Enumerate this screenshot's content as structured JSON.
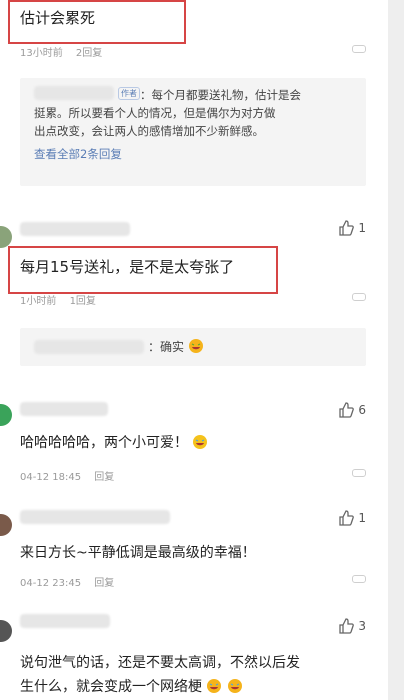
{
  "comments": [
    {
      "text": "估计会累死",
      "time": "13小时前",
      "replies": "2回复"
    },
    {
      "text": "每月15号送礼，是不是太夸张了",
      "time": "1小时前",
      "replies": "1回复",
      "likes": "1"
    },
    {
      "text": "哈哈哈哈哈，两个小可爱！",
      "time": "04-12 18:45",
      "reply_action": "回复",
      "likes": "6"
    },
    {
      "text": "来日方长~平静低调是最高级的幸福！",
      "time": "04-12 23:45",
      "reply_action": "回复",
      "likes": "1"
    },
    {
      "text_line1": "说句泄气的话，还是不要太高调，不然以后发",
      "text_line2": "生什么，就会变成一个网络梗",
      "likes": "3"
    }
  ],
  "reply_block_1": {
    "badge": "作者",
    "line1": "：每个月都要送礼物，估计是会",
    "line2": "挺累。所以要看个人的情况，但是偶尔为对方做",
    "line3": "出点改变，会让两人的感情增加不少新鲜感。",
    "link": "查看全部2条回复"
  },
  "reply_block_2": {
    "text": "：确实"
  },
  "colors": {
    "highlight": "#d64545",
    "link": "#5a7db5",
    "panel": "#f4f4f4"
  },
  "icons": [
    "thumbs-up-icon",
    "more-options-icon",
    "laughing-crying-emoji",
    "rolling-laughing-emoji"
  ]
}
